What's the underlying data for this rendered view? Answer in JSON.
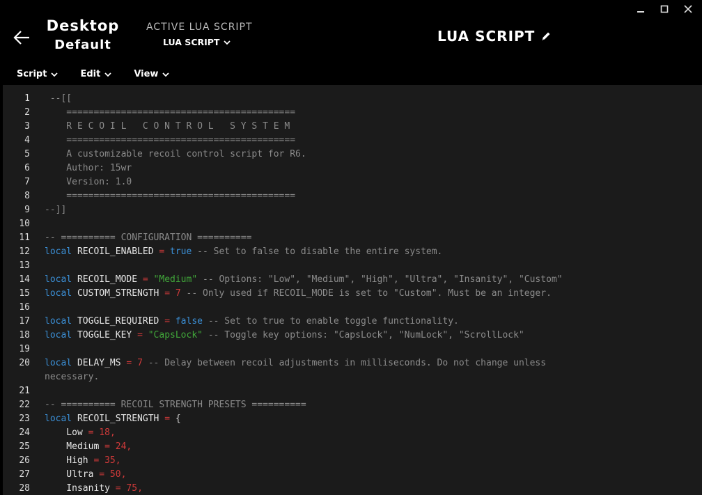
{
  "header": {
    "profile_name": "Desktop",
    "profile_sub": "Default",
    "active_label": "ACTIVE LUA SCRIPT",
    "active_value": "LUA SCRIPT",
    "title": "LUA SCRIPT"
  },
  "menu": [
    {
      "label": "Script"
    },
    {
      "label": "Edit"
    },
    {
      "label": "View"
    }
  ],
  "icons": {
    "back": "back-arrow-icon",
    "edit": "pencil-icon",
    "minimize": "minimize-icon",
    "maximize": "maximize-icon",
    "close": "close-icon"
  },
  "colors": {
    "keyword": "#3b8fd6",
    "string": "#41a83a",
    "number": "#d03a3a",
    "comment": "#8b8b8b",
    "editor_bg": "#1b1b1b"
  },
  "code": [
    {
      "n": "1",
      "t": [
        [
          "c",
          " --[["
        ]
      ]
    },
    {
      "n": "2",
      "t": [
        [
          "c",
          "    =========================================="
        ]
      ]
    },
    {
      "n": "3",
      "t": [
        [
          "c",
          "    R E C O I L   C O N T R O L   S Y S T E M"
        ]
      ]
    },
    {
      "n": "4",
      "t": [
        [
          "c",
          "    =========================================="
        ]
      ]
    },
    {
      "n": "5",
      "t": [
        [
          "c",
          "    A customizable recoil control script for R6."
        ]
      ]
    },
    {
      "n": "6",
      "t": [
        [
          "c",
          "    Author: 15wr"
        ]
      ]
    },
    {
      "n": "7",
      "t": [
        [
          "c",
          "    Version: 1.0"
        ]
      ]
    },
    {
      "n": "8",
      "t": [
        [
          "c",
          "    =========================================="
        ]
      ]
    },
    {
      "n": "9",
      "t": [
        [
          "c",
          "--]]"
        ]
      ]
    },
    {
      "n": "10",
      "t": []
    },
    {
      "n": "11",
      "t": [
        [
          "c",
          "-- ========== CONFIGURATION =========="
        ]
      ]
    },
    {
      "n": "12",
      "t": [
        [
          "k",
          "local"
        ],
        [
          "id",
          " RECOIL_ENABLED "
        ],
        [
          "o",
          "="
        ],
        [
          "k",
          " true"
        ],
        [
          "c",
          " -- Set to false to disable the entire system."
        ]
      ]
    },
    {
      "n": "13",
      "t": []
    },
    {
      "n": "14",
      "t": [
        [
          "k",
          "local"
        ],
        [
          "id",
          " RECOIL_MODE "
        ],
        [
          "o",
          "="
        ],
        [
          "s",
          " \"Medium\""
        ],
        [
          "c",
          " -- Options: \"Low\", \"Medium\", \"High\", \"Ultra\", \"Insanity\", \"Custom\""
        ]
      ]
    },
    {
      "n": "15",
      "t": [
        [
          "k",
          "local"
        ],
        [
          "id",
          " CUSTOM_STRENGTH "
        ],
        [
          "o",
          "="
        ],
        [
          "n",
          " 7"
        ],
        [
          "c",
          " -- Only used if RECOIL_MODE is set to \"Custom\". Must be an integer."
        ]
      ]
    },
    {
      "n": "16",
      "t": []
    },
    {
      "n": "17",
      "t": [
        [
          "k",
          "local"
        ],
        [
          "id",
          " TOGGLE_REQUIRED "
        ],
        [
          "o",
          "="
        ],
        [
          "k",
          " false"
        ],
        [
          "c",
          " -- Set to true to enable toggle functionality."
        ]
      ]
    },
    {
      "n": "18",
      "t": [
        [
          "k",
          "local"
        ],
        [
          "id",
          " TOGGLE_KEY "
        ],
        [
          "o",
          "="
        ],
        [
          "s",
          " \"CapsLock\""
        ],
        [
          "c",
          " -- Toggle key options: \"CapsLock\", \"NumLock\", \"ScrollLock\""
        ]
      ]
    },
    {
      "n": "19",
      "t": []
    },
    {
      "n": "20",
      "t": [
        [
          "k",
          "local"
        ],
        [
          "id",
          " DELAY_MS "
        ],
        [
          "o",
          "="
        ],
        [
          "n",
          " 7"
        ],
        [
          "c",
          " -- Delay between recoil adjustments in milliseconds. Do not change unless"
        ]
      ]
    },
    {
      "n": "",
      "t": [
        [
          "c",
          "necessary."
        ]
      ]
    },
    {
      "n": "21",
      "t": []
    },
    {
      "n": "22",
      "t": [
        [
          "c",
          "-- ========== RECOIL STRENGTH PRESETS =========="
        ]
      ]
    },
    {
      "n": "23",
      "t": [
        [
          "k",
          "local"
        ],
        [
          "id",
          " RECOIL_STRENGTH "
        ],
        [
          "o",
          "="
        ],
        [
          "p",
          " {"
        ]
      ]
    },
    {
      "n": "24",
      "t": [
        [
          "id",
          "    Low "
        ],
        [
          "o",
          "="
        ],
        [
          "n",
          " 18"
        ],
        [
          "o",
          ","
        ]
      ]
    },
    {
      "n": "25",
      "t": [
        [
          "id",
          "    Medium "
        ],
        [
          "o",
          "="
        ],
        [
          "n",
          " 24"
        ],
        [
          "o",
          ","
        ]
      ]
    },
    {
      "n": "26",
      "t": [
        [
          "id",
          "    High "
        ],
        [
          "o",
          "="
        ],
        [
          "n",
          " 35"
        ],
        [
          "o",
          ","
        ]
      ]
    },
    {
      "n": "27",
      "t": [
        [
          "id",
          "    Ultra "
        ],
        [
          "o",
          "="
        ],
        [
          "n",
          " 50"
        ],
        [
          "o",
          ","
        ]
      ]
    },
    {
      "n": "28",
      "t": [
        [
          "id",
          "    Insanity "
        ],
        [
          "o",
          "="
        ],
        [
          "n",
          " 75"
        ],
        [
          "o",
          ","
        ]
      ]
    }
  ]
}
